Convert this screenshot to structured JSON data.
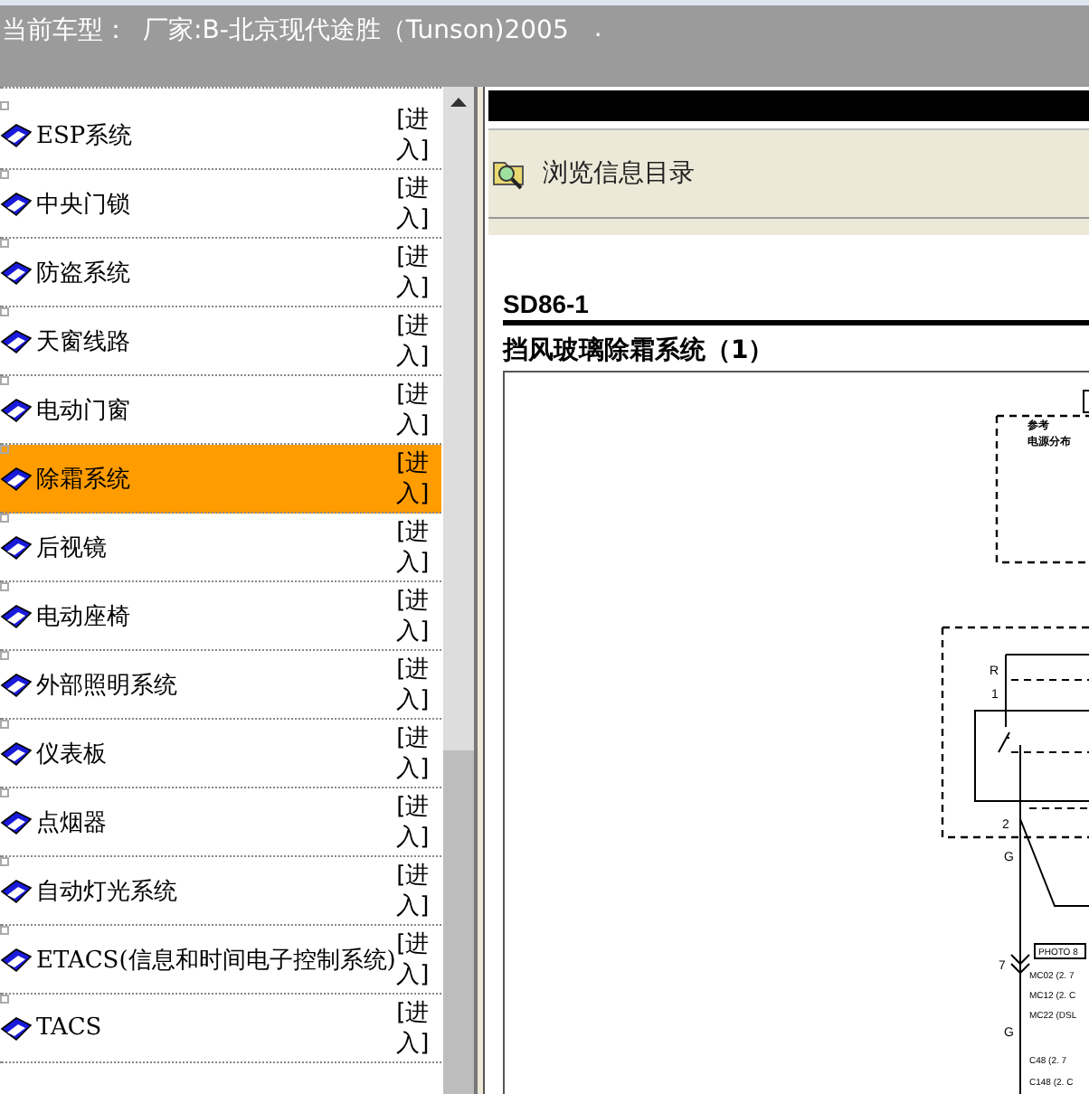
{
  "header": {
    "label": "当前车型：",
    "vehicle": "厂家:B-北京现代途胜（Tunson)2005",
    "dot": "."
  },
  "systems": [
    {
      "name": "ESP系统",
      "link": "[进入]",
      "selected": false
    },
    {
      "name": "中央门锁",
      "link": "[进入]",
      "selected": false
    },
    {
      "name": "防盗系统",
      "link": "[进入]",
      "selected": false
    },
    {
      "name": "天窗线路",
      "link": "[进入]",
      "selected": false
    },
    {
      "name": "电动门窗",
      "link": "[进入]",
      "selected": false
    },
    {
      "name": "除霜系统",
      "link": "[进入]",
      "selected": true
    },
    {
      "name": "后视镜",
      "link": "[进入]",
      "selected": false
    },
    {
      "name": "电动座椅",
      "link": "[进入]",
      "selected": false
    },
    {
      "name": "外部照明系统",
      "link": "[进入]",
      "selected": false
    },
    {
      "name": "仪表板",
      "link": "[进入]",
      "selected": false
    },
    {
      "name": "点烟器",
      "link": "[进入]",
      "selected": false
    },
    {
      "name": "自动灯光系统",
      "link": "[进入]",
      "selected": false
    },
    {
      "name": "ETACS(信息和时间电子控制系统)",
      "link": "[进入]",
      "selected": false
    },
    {
      "name": "TACS",
      "link": "[进入]",
      "selected": false
    }
  ],
  "toolbar": {
    "label": "浏览信息目录"
  },
  "document": {
    "code": "SD86-1",
    "title": "挡风玻璃除霜系统（1）",
    "diagram_labels": [
      {
        "kind": "ref",
        "text": "参考"
      },
      {
        "kind": "ref",
        "text": "电源分布"
      },
      {
        "kind": "wire",
        "text": "R"
      },
      {
        "kind": "pin",
        "text": "1"
      },
      {
        "kind": "pin",
        "text": "2"
      },
      {
        "kind": "wire",
        "text": "G"
      },
      {
        "kind": "photo",
        "text": "PHOTO 8"
      },
      {
        "kind": "pin",
        "text": "7"
      },
      {
        "kind": "conn",
        "text": "MC02 (2. 7"
      },
      {
        "kind": "conn",
        "text": "MC12 (2. C"
      },
      {
        "kind": "conn",
        "text": "MC22 (DSL"
      },
      {
        "kind": "wire",
        "text": "G"
      },
      {
        "kind": "conn",
        "text": "C48 (2. 7"
      },
      {
        "kind": "conn",
        "text": "C148 (2. C"
      }
    ]
  }
}
